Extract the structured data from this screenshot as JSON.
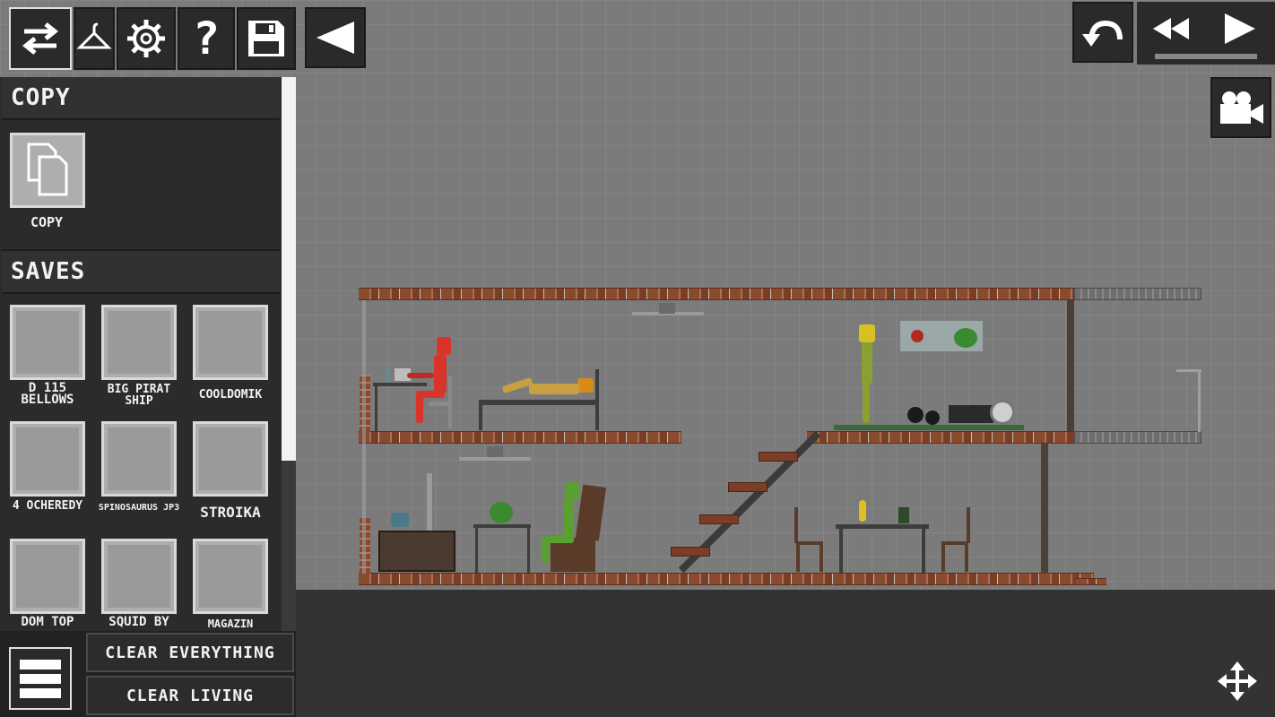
{
  "colors": {
    "panel": "#2b2b2b",
    "button": "#2a2a2a",
    "text": "#f2f2f2",
    "ground": "#333333",
    "world": "#7b7b7b"
  },
  "toolbar": {
    "icons": [
      "swap-arrows-icon",
      "hanger-icon",
      "gear-icon",
      "help-icon",
      "save-disk-icon",
      "collapse-triangle-icon"
    ],
    "help_glyph": "?"
  },
  "top_right": {
    "icons": [
      "undo-icon",
      "rewind-icon",
      "play-icon",
      "camera-icon"
    ]
  },
  "copy_section": {
    "header": "COPY",
    "item_label": "COPY"
  },
  "saves_section": {
    "header": "SAVES",
    "items": [
      {
        "label": "D 115 BELLOWS"
      },
      {
        "label": "BIG PIRAT SHIP"
      },
      {
        "label": "COOLDOMIK"
      },
      {
        "label": "4 OCHEREDY"
      },
      {
        "label": "SPINOSAURUS JP3"
      },
      {
        "label": "STROIKA"
      },
      {
        "label": "DOM TOP"
      },
      {
        "label": "SQUID BY"
      },
      {
        "label": "MAGAZIN"
      }
    ]
  },
  "bottom": {
    "clear_everything": "CLEAR EVERYTHING",
    "clear_living": "CLEAR LIVING",
    "menu_icon": "hamburger-menu-icon",
    "move_icon": "move-arrows-icon"
  }
}
